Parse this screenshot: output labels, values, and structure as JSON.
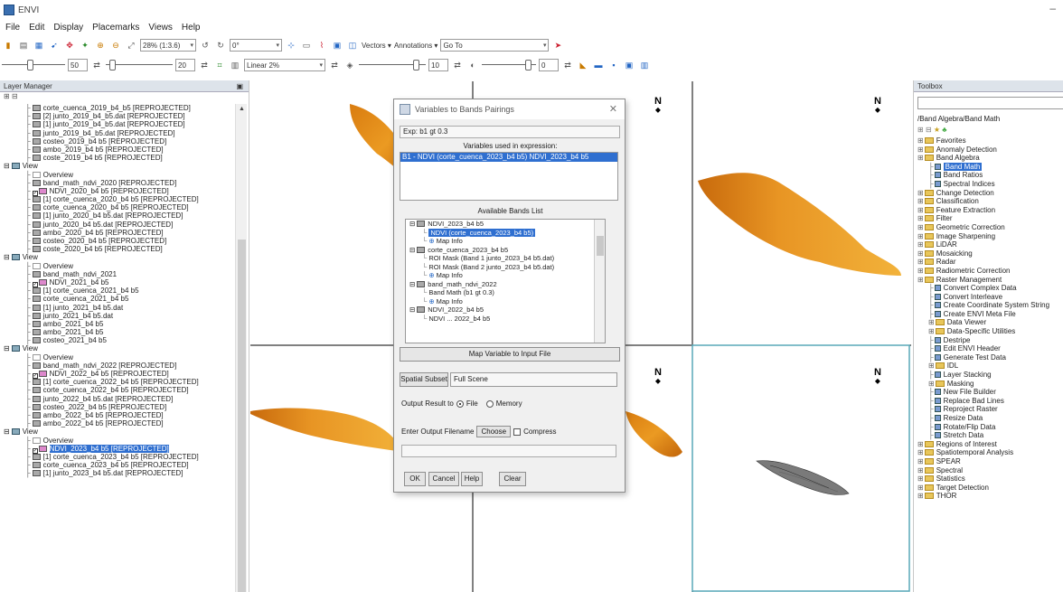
{
  "window": {
    "title": "ENVI"
  },
  "menu": [
    "File",
    "Edit",
    "Display",
    "Placemarks",
    "Views",
    "Help"
  ],
  "toolbar1": {
    "zoom_value": "28% (1:3.6)",
    "rotate_value": "0°",
    "vectors_label": "Vectors",
    "annotations_label": "Annotations",
    "goto_value": "Go To"
  },
  "toolbar2": {
    "brightness_value": "50",
    "contrast_value": "20",
    "stretch_value": "Linear 2%",
    "sharpen_value": "10",
    "transparency_value": "0"
  },
  "layer_manager": {
    "title": "Layer Manager",
    "rows": [
      {
        "indent": 1,
        "icon": "band",
        "label": "corte_cuenca_2019_b4_b5 [REPROJECTED]"
      },
      {
        "indent": 1,
        "icon": "band",
        "label": "[2] junto_2019_b4_b5.dat [REPROJECTED]"
      },
      {
        "indent": 1,
        "icon": "band",
        "label": "[1] junto_2019_b4_b5.dat [REPROJECTED]"
      },
      {
        "indent": 1,
        "icon": "band",
        "label": "junto_2019_b4_b5.dat [REPROJECTED]"
      },
      {
        "indent": 1,
        "icon": "band",
        "label": "costeo_2019_b4 b5 [REPROJECTED]"
      },
      {
        "indent": 1,
        "icon": "band",
        "label": "ambo_2019_b4 b5 [REPROJECTED]"
      },
      {
        "indent": 1,
        "icon": "band",
        "label": "coste_2019_b4 b5 [REPROJECTED]"
      },
      {
        "indent": 0,
        "icon": "view",
        "label": "View"
      },
      {
        "indent": 1,
        "icon": "ov",
        "label": "Overview"
      },
      {
        "indent": 1,
        "icon": "band",
        "label": "band_math_ndvi_2020 [REPROJECTED]"
      },
      {
        "indent": 1,
        "icon": "ndvi",
        "label": "NDVI_2020_b4 b5 [REPROJECTED]",
        "checked": true
      },
      {
        "indent": 1,
        "icon": "band",
        "label": "[1] corte_cuenca_2020_b4 b5 [REPROJECTED]"
      },
      {
        "indent": 1,
        "icon": "band",
        "label": "corte_cuenca_2020_b4 b5 [REPROJECTED]"
      },
      {
        "indent": 1,
        "icon": "band",
        "label": "[1] junto_2020_b4 b5.dat [REPROJECTED]"
      },
      {
        "indent": 1,
        "icon": "band",
        "label": "junto_2020_b4 b5.dat [REPROJECTED]"
      },
      {
        "indent": 1,
        "icon": "band",
        "label": "ambo_2020_b4 b5 [REPROJECTED]"
      },
      {
        "indent": 1,
        "icon": "band",
        "label": "costeo_2020_b4 b5 [REPROJECTED]"
      },
      {
        "indent": 1,
        "icon": "band",
        "label": "coste_2020_b4 b5 [REPROJECTED]"
      },
      {
        "indent": 0,
        "icon": "view",
        "label": "View"
      },
      {
        "indent": 1,
        "icon": "ov",
        "label": "Overview"
      },
      {
        "indent": 1,
        "icon": "band",
        "label": "band_math_ndvi_2021"
      },
      {
        "indent": 1,
        "icon": "ndvi",
        "label": "NDVI_2021_b4 b5",
        "checked": true
      },
      {
        "indent": 1,
        "icon": "band",
        "label": "[1] corte_cuenca_2021_b4 b5"
      },
      {
        "indent": 1,
        "icon": "band",
        "label": "corte_cuenca_2021_b4 b5"
      },
      {
        "indent": 1,
        "icon": "band",
        "label": "[1] junto_2021_b4 b5.dat"
      },
      {
        "indent": 1,
        "icon": "band",
        "label": "junto_2021_b4 b5.dat"
      },
      {
        "indent": 1,
        "icon": "band",
        "label": "ambo_2021_b4 b5"
      },
      {
        "indent": 1,
        "icon": "band",
        "label": "ambo_2021_b4 b5"
      },
      {
        "indent": 1,
        "icon": "band",
        "label": "costeo_2021_b4 b5"
      },
      {
        "indent": 0,
        "icon": "view",
        "label": "View"
      },
      {
        "indent": 1,
        "icon": "ov",
        "label": "Overview"
      },
      {
        "indent": 1,
        "icon": "band",
        "label": "band_math_ndvi_2022 [REPROJECTED]"
      },
      {
        "indent": 1,
        "icon": "ndvi",
        "label": "NDVI_2022_b4 b5 [REPROJECTED]",
        "checked": true
      },
      {
        "indent": 1,
        "icon": "band",
        "label": "[1] corte_cuenca_2022_b4 b5 [REPROJECTED]"
      },
      {
        "indent": 1,
        "icon": "band",
        "label": "corte_cuenca_2022_b4 b5 [REPROJECTED]"
      },
      {
        "indent": 1,
        "icon": "band",
        "label": "junto_2022_b4 b5.dat [REPROJECTED]"
      },
      {
        "indent": 1,
        "icon": "band",
        "label": "costeo_2022_b4 b5 [REPROJECTED]"
      },
      {
        "indent": 1,
        "icon": "band",
        "label": "ambo_2022_b4 b5 [REPROJECTED]"
      },
      {
        "indent": 1,
        "icon": "band",
        "label": "ambo_2022_b4 b5 [REPROJECTED]"
      },
      {
        "indent": 0,
        "icon": "view",
        "label": "View"
      },
      {
        "indent": 1,
        "icon": "ov",
        "label": "Overview"
      },
      {
        "indent": 1,
        "icon": "ndvi",
        "label": "NDVI_2023_b4 b5 [REPROJECTED]",
        "checked": true,
        "selected": true
      },
      {
        "indent": 1,
        "icon": "band",
        "label": "[1] corte_cuenca_2023_b4 b5 [REPROJECTED]"
      },
      {
        "indent": 1,
        "icon": "band",
        "label": "corte_cuenca_2023_b4 b5 [REPROJECTED]"
      },
      {
        "indent": 1,
        "icon": "band",
        "label": "[1] junto_2023_b4 b5.dat [REPROJECTED]"
      }
    ]
  },
  "dialog": {
    "title": "Variables to Bands Pairings",
    "expression": "Exp: b1 gt 0.3",
    "vars_label": "Variables used in expression:",
    "vars_item": "B1 - NDVI (corte_cuenca_2023_b4 b5) NDVI_2023_b4 b5",
    "avail_label": "Available Bands List",
    "avail_rows": [
      {
        "indent": 0,
        "label": "NDVI_2023_b4 b5",
        "icon": "band"
      },
      {
        "indent": 1,
        "label": "NDVI (corte_cuenca_2023_b4 b5)",
        "icon": "none",
        "hl": true
      },
      {
        "indent": 1,
        "label": "Map Info",
        "icon": "map"
      },
      {
        "indent": 0,
        "label": "corte_cuenca_2023_b4 b5",
        "icon": "band"
      },
      {
        "indent": 1,
        "label": "ROI Mask (Band 1 junto_2023_b4 b5.dat)",
        "icon": "none"
      },
      {
        "indent": 1,
        "label": "ROI Mask (Band 2 junto_2023_b4 b5.dat)",
        "icon": "none"
      },
      {
        "indent": 1,
        "label": "Map Info",
        "icon": "map"
      },
      {
        "indent": 0,
        "label": "band_math_ndvi_2022",
        "icon": "band"
      },
      {
        "indent": 1,
        "label": "Band Math (b1 gt 0.3)",
        "icon": "none"
      },
      {
        "indent": 1,
        "label": "Map Info",
        "icon": "map"
      },
      {
        "indent": 0,
        "label": "NDVI_2022_b4 b5",
        "icon": "band"
      },
      {
        "indent": 1,
        "label": "NDVI ... 2022_b4 b5",
        "icon": "none"
      }
    ],
    "map_btn": "Map Variable to Input File",
    "subset_btn": "Spatial Subset",
    "subset_value": "Full Scene",
    "output_label": "Output Result to",
    "file_label": "File",
    "memory_label": "Memory",
    "filename_label": "Enter Output Filename",
    "choose_btn": "Choose",
    "compress_label": "Compress",
    "ok_btn": "OK",
    "cancel_btn": "Cancel",
    "help_btn": "Help",
    "clear_btn": "Clear"
  },
  "toolbox": {
    "title": "Toolbox",
    "crumb": "/Band Algebra/Band Math",
    "rows": [
      {
        "indent": 0,
        "type": "fold",
        "label": "Favorites"
      },
      {
        "indent": 0,
        "type": "fold",
        "label": "Anomaly Detection"
      },
      {
        "indent": 0,
        "type": "fold",
        "label": "Band Algebra"
      },
      {
        "indent": 1,
        "type": "tool",
        "label": "Band Math",
        "selected": true
      },
      {
        "indent": 1,
        "type": "tool",
        "label": "Band Ratios"
      },
      {
        "indent": 1,
        "type": "tool",
        "label": "Spectral Indices"
      },
      {
        "indent": 0,
        "type": "fold",
        "label": "Change Detection"
      },
      {
        "indent": 0,
        "type": "fold",
        "label": "Classification"
      },
      {
        "indent": 0,
        "type": "fold",
        "label": "Feature Extraction"
      },
      {
        "indent": 0,
        "type": "fold",
        "label": "Filter"
      },
      {
        "indent": 0,
        "type": "fold",
        "label": "Geometric Correction"
      },
      {
        "indent": 0,
        "type": "fold",
        "label": "Image Sharpening"
      },
      {
        "indent": 0,
        "type": "fold",
        "label": "LiDAR"
      },
      {
        "indent": 0,
        "type": "fold",
        "label": "Mosaicking"
      },
      {
        "indent": 0,
        "type": "fold",
        "label": "Radar"
      },
      {
        "indent": 0,
        "type": "fold",
        "label": "Radiometric Correction"
      },
      {
        "indent": 0,
        "type": "fold",
        "label": "Raster Management"
      },
      {
        "indent": 1,
        "type": "tool",
        "label": "Convert Complex Data"
      },
      {
        "indent": 1,
        "type": "tool",
        "label": "Convert Interleave"
      },
      {
        "indent": 1,
        "type": "tool",
        "label": "Create Coordinate System String"
      },
      {
        "indent": 1,
        "type": "tool",
        "label": "Create ENVI Meta File"
      },
      {
        "indent": 1,
        "type": "fold",
        "label": "Data Viewer"
      },
      {
        "indent": 1,
        "type": "fold",
        "label": "Data-Specific Utilities"
      },
      {
        "indent": 1,
        "type": "tool",
        "label": "Destripe"
      },
      {
        "indent": 1,
        "type": "tool",
        "label": "Edit ENVI Header"
      },
      {
        "indent": 1,
        "type": "tool",
        "label": "Generate Test Data"
      },
      {
        "indent": 1,
        "type": "fold",
        "label": "IDL"
      },
      {
        "indent": 1,
        "type": "tool",
        "label": "Layer Stacking"
      },
      {
        "indent": 1,
        "type": "fold",
        "label": "Masking"
      },
      {
        "indent": 1,
        "type": "tool",
        "label": "New File Builder"
      },
      {
        "indent": 1,
        "type": "tool",
        "label": "Replace Bad Lines"
      },
      {
        "indent": 1,
        "type": "tool",
        "label": "Reproject Raster"
      },
      {
        "indent": 1,
        "type": "tool",
        "label": "Resize Data"
      },
      {
        "indent": 1,
        "type": "tool",
        "label": "Rotate/Flip Data"
      },
      {
        "indent": 1,
        "type": "tool",
        "label": "Stretch Data"
      },
      {
        "indent": 0,
        "type": "fold",
        "label": "Regions of Interest"
      },
      {
        "indent": 0,
        "type": "fold",
        "label": "Spatiotemporal Analysis"
      },
      {
        "indent": 0,
        "type": "fold",
        "label": "SPEAR"
      },
      {
        "indent": 0,
        "type": "fold",
        "label": "Spectral"
      },
      {
        "indent": 0,
        "type": "fold",
        "label": "Statistics"
      },
      {
        "indent": 0,
        "type": "fold",
        "label": "Target Detection"
      },
      {
        "indent": 0,
        "type": "fold",
        "label": "THOR"
      }
    ]
  },
  "north_label": "N",
  "colors": {
    "ndvi_orange": "#e58a14",
    "ndvi_dark": "#b85a08",
    "selection": "#2f6fd0"
  }
}
